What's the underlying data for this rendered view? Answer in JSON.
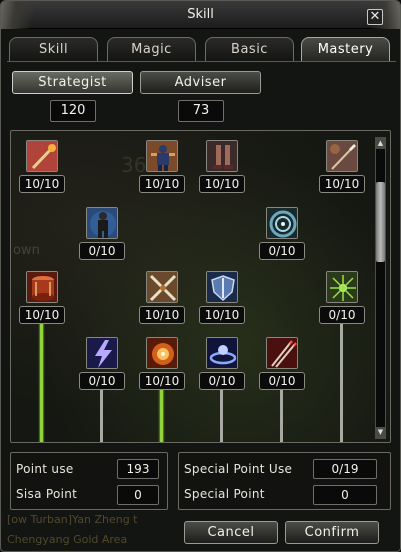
{
  "window": {
    "title": "Skill",
    "close_label": "✕"
  },
  "tabs": [
    {
      "label": "Skill"
    },
    {
      "label": "Magic"
    },
    {
      "label": "Basic"
    },
    {
      "label": "Mastery",
      "active": true
    }
  ],
  "classes": [
    {
      "label": "Strategist",
      "points": "120",
      "active": true
    },
    {
      "label": "Adviser",
      "points": "73"
    }
  ],
  "background_text": {
    "tree_number": "36",
    "tree_word": "own",
    "chat_line_1": "[ow Turban]Yan Zheng t",
    "chat_line_2": "Chengyang Gold Area"
  },
  "skills": [
    {
      "id": "staff-strike",
      "level": "10/10",
      "icon": "staff-icon",
      "color": "#b0443a"
    },
    {
      "id": "warrior-stance",
      "level": "10/10",
      "icon": "warrior-icon",
      "color": "#7a4a2a"
    },
    {
      "id": "swift-boots",
      "level": "10/10",
      "icon": "boots-icon",
      "color": "#5a3a3a"
    },
    {
      "id": "spear-thrust",
      "level": "10/10",
      "icon": "spear-icon",
      "color": "#6a4a40"
    },
    {
      "id": "iron-body",
      "level": "0/10",
      "icon": "iron-body-icon",
      "color": "#3a6aa8"
    },
    {
      "id": "vortex",
      "level": "0/10",
      "icon": "vortex-icon",
      "color": "#3a6a7a"
    },
    {
      "id": "war-drum",
      "level": "10/10",
      "icon": "drum-icon",
      "color": "#a8381e"
    },
    {
      "id": "crossed-blades",
      "level": "10/10",
      "icon": "crossed-blades-icon",
      "color": "#8a5a3a"
    },
    {
      "id": "iron-shield",
      "level": "10/10",
      "icon": "shield-icon",
      "color": "#3a5a8a"
    },
    {
      "id": "spirit-burst",
      "level": "0/10",
      "icon": "spirit-burst-icon",
      "color": "#4a6a2a"
    },
    {
      "id": "lightning",
      "level": "0/10",
      "icon": "lightning-icon",
      "color": "#3a3a8a"
    },
    {
      "id": "flame-orb",
      "level": "10/10",
      "icon": "flame-orb-icon",
      "color": "#c0601a"
    },
    {
      "id": "frost-ring",
      "level": "0/10",
      "icon": "frost-ring-icon",
      "color": "#3a4a9a"
    },
    {
      "id": "twin-spear",
      "level": "0/10",
      "icon": "twin-spear-icon",
      "color": "#8a2a2a"
    }
  ],
  "stats": {
    "point_use_label": "Point use",
    "point_use_value": "193",
    "sisa_point_label": "Sisa Point",
    "sisa_point_value": "0",
    "special_use_label": "Special Point Use",
    "special_use_value": "0/19",
    "special_point_label": "Special Point",
    "special_point_value": "0"
  },
  "actions": {
    "cancel": "Cancel",
    "confirm": "Confirm"
  },
  "colors": {
    "learned_line": "#8ed43a",
    "locked_line": "#a9a9a4"
  }
}
